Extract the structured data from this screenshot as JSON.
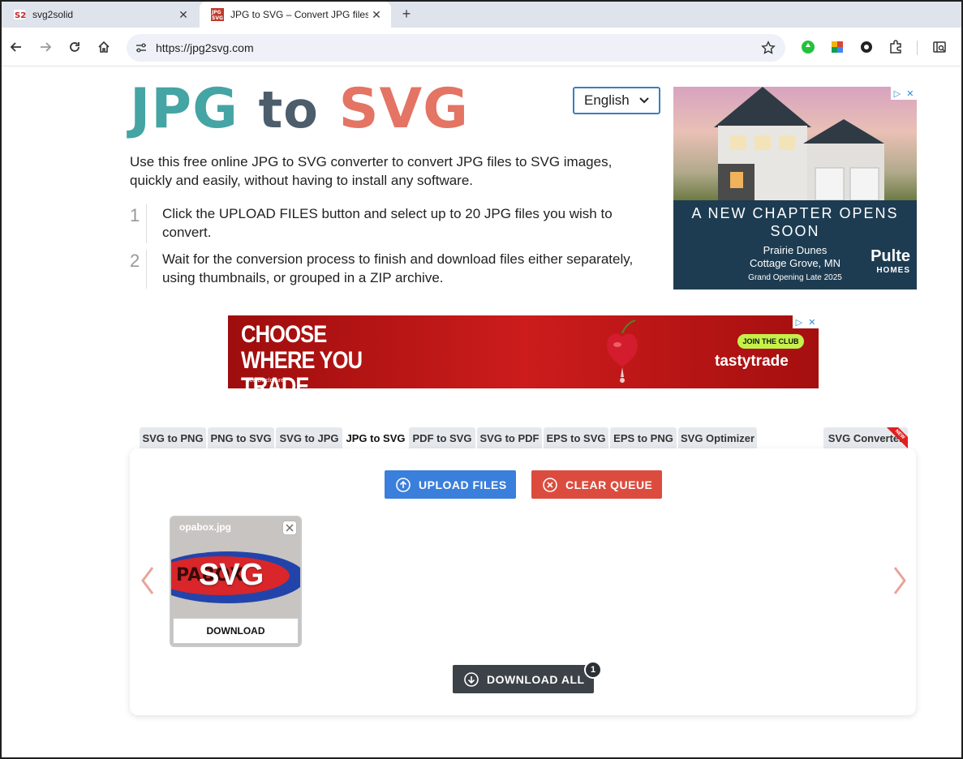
{
  "browser": {
    "tabs": [
      {
        "title": "svg2solid",
        "active": false
      },
      {
        "title": "JPG to SVG – Convert JPG files to",
        "active": true
      }
    ],
    "url": "https://jpg2svg.com"
  },
  "page": {
    "logo": {
      "part1": "JPG",
      "part2": "to",
      "part3": "SVG"
    },
    "language": "English",
    "intro": "Use this free online JPG to SVG converter to convert JPG files to SVG images, quickly and easily, without having to install any software.",
    "steps": [
      {
        "num": "1",
        "text": "Click the UPLOAD FILES button and select up to 20 JPG files you wish to convert."
      },
      {
        "num": "2",
        "text": "Wait for the conversion process to finish and download files either separately, using thumbnails, or grouped in a ZIP archive."
      }
    ]
  },
  "ad_house": {
    "headline": "A NEW CHAPTER OPENS SOON",
    "location1": "Prairie Dunes",
    "location2": "Cottage Grove, MN",
    "date": "Grand Opening Late 2025",
    "brand": "Pulte",
    "brand_sub": "HOMES"
  },
  "ad_trade": {
    "headline": "CHOOSE WHERE YOU TRADE",
    "disclosure": "See Disclosure",
    "cta": "JOIN THE CLUB",
    "brand": "tastytrade"
  },
  "converter": {
    "tabs": [
      "SVG to PNG",
      "PNG to SVG",
      "SVG to JPG",
      "JPG to SVG",
      "PDF to SVG",
      "SVG to PDF",
      "EPS to SVG",
      "EPS to PNG",
      "SVG Optimizer",
      "SVG Converter"
    ],
    "active_tab": "JPG to SVG",
    "new_ribbon": "NEW",
    "upload_label": "UPLOAD FILES",
    "clear_label": "CLEAR QUEUE",
    "file": {
      "name": "opabox.jpg",
      "badge_text": "SVG",
      "download_label": "DOWNLOAD"
    },
    "download_all_label": "DOWNLOAD ALL",
    "download_count": "1"
  },
  "colors": {
    "upload": "#3a7fdb",
    "clear": "#db4c3f",
    "download_all": "#3c4248",
    "logo_teal": "#45a4a4",
    "logo_slate": "#4c5d6b",
    "logo_coral": "#e47463"
  }
}
